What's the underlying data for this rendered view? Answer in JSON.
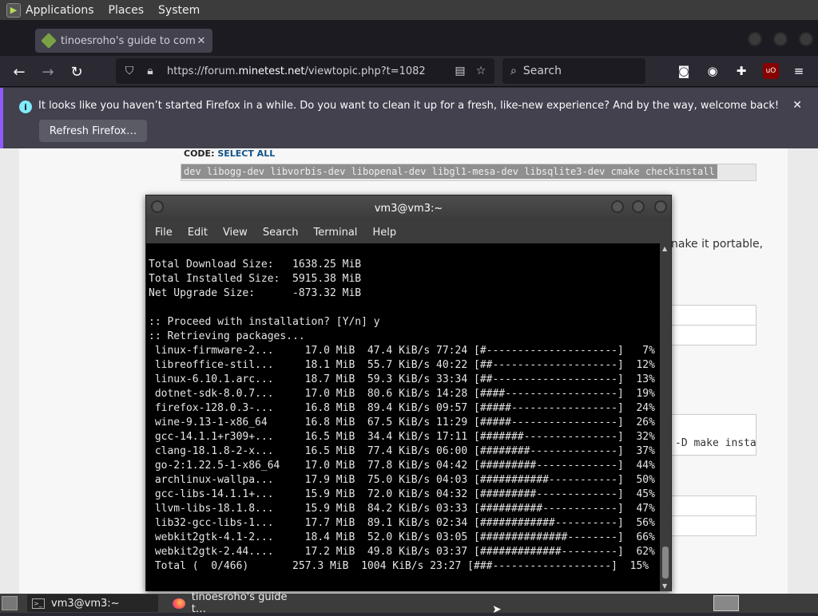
{
  "top_panel": {
    "menus": [
      "Applications",
      "Places",
      "System"
    ]
  },
  "browser": {
    "tab_title": "tinoesroho's guide to comp",
    "url_host_prefix": "https://forum.",
    "url_host": "minetest.net",
    "url_path": "/viewtopic.php?t=1082",
    "search_placeholder": "Search",
    "notification_text": "It looks like you haven’t started Firefox in a while. Do you want to clean it up for a fresh, like-new experience? And by the way, welcome back!",
    "refresh_button": "Refresh Firefox…"
  },
  "page": {
    "code_label": "CODE: ",
    "select_all": "SELECT ALL",
    "code_text": "dev libogg-dev libvorbis-dev libopenal-dev libgl1-mesa-dev libsqlite3-dev cmake checkinstall",
    "side_text": "nake it portable,",
    "mono_fragment": "-D make insta"
  },
  "terminal": {
    "title": "vm3@vm3:~",
    "menu": [
      "File",
      "Edit",
      "View",
      "Search",
      "Terminal",
      "Help"
    ],
    "lines": [
      "Total Download Size:   1638.25 MiB",
      "Total Installed Size:  5915.38 MiB",
      "Net Upgrade Size:      -873.32 MiB",
      "",
      ":: Proceed with installation? [Y/n] y",
      ":: Retrieving packages...",
      " linux-firmware-2...     17.0 MiB  47.4 KiB/s 77:24 [#---------------------]   7%",
      " libreoffice-stil...     18.1 MiB  55.7 KiB/s 40:22 [##--------------------]  12%",
      " linux-6.10.1.arc...     18.7 MiB  59.3 KiB/s 33:34 [##--------------------]  13%",
      " dotnet-sdk-8.0.7...     17.0 MiB  80.6 KiB/s 14:28 [####------------------]  19%",
      " firefox-128.0.3-...     16.8 MiB  89.4 KiB/s 09:57 [#####-----------------]  24%",
      " wine-9.13-1-x86_64      16.8 MiB  67.5 KiB/s 11:29 [#####-----------------]  26%",
      " gcc-14.1.1+r309+...     16.5 MiB  34.4 KiB/s 17:11 [#######---------------]  32%",
      " clang-18.1.8-2-x...     16.5 MiB  77.4 KiB/s 06:00 [########--------------]  37%",
      " go-2:1.22.5-1-x86_64    17.0 MiB  77.8 KiB/s 04:42 [#########-------------]  44%",
      " archlinux-wallpa...     17.9 MiB  75.0 KiB/s 04:03 [###########-----------]  50%",
      " gcc-libs-14.1.1+...     15.9 MiB  72.0 KiB/s 04:32 [#########-------------]  45%",
      " llvm-libs-18.1.8...     15.9 MiB  84.2 KiB/s 03:33 [##########------------]  47%",
      " lib32-gcc-libs-1...     17.7 MiB  89.1 KiB/s 02:34 [############----------]  56%",
      " webkit2gtk-4.1-2...     18.4 MiB  52.0 KiB/s 03:05 [##############--------]  66%",
      " webkit2gtk-2.44....     17.2 MiB  49.8 KiB/s 03:37 [#############---------]  62%",
      " Total (  0/466)       257.3 MiB  1004 KiB/s 23:27 [###-------------------]  15%"
    ]
  },
  "taskbar": {
    "task_terminal": "vm3@vm3:~",
    "task_firefox": "tinoesroho's guide t…"
  }
}
